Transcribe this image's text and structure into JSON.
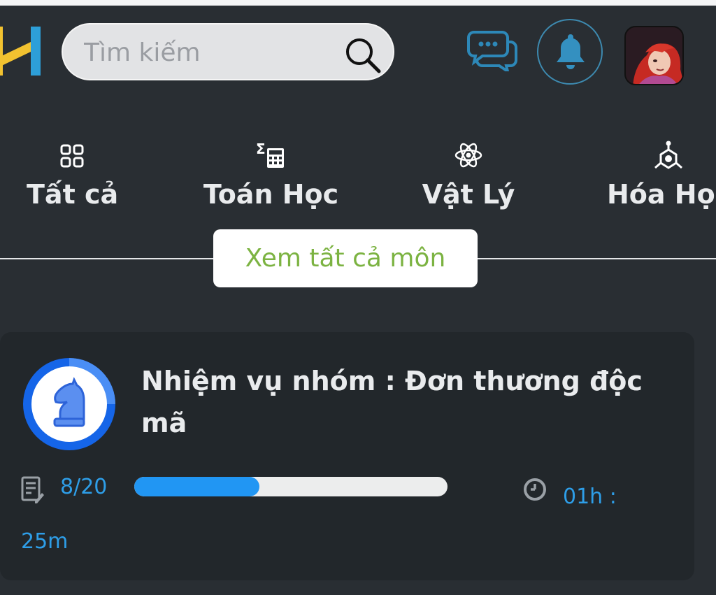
{
  "header": {
    "search_placeholder": "Tìm kiếm"
  },
  "subjects": [
    {
      "label": "Tất cả",
      "icon": "grid-icon"
    },
    {
      "label": "Toán Học",
      "icon": "calculator-icon"
    },
    {
      "label": "Vật Lý",
      "icon": "atom-icon"
    },
    {
      "label": "Hóa Họ",
      "icon": "molecule-icon"
    }
  ],
  "see_all_label": "Xem tất cả môn",
  "quest": {
    "title": "Nhiệm vụ nhóm : Đơn thương độc mã",
    "progress_text": "8/20",
    "progress_fraction": 0.4,
    "time_left": "01h : 25m"
  },
  "colors": {
    "background": "#292e33",
    "accent_blue": "#2196f3",
    "accent_green": "#7cb342",
    "logo_yellow": "#f2c230",
    "logo_blue": "#2d9fd8"
  }
}
